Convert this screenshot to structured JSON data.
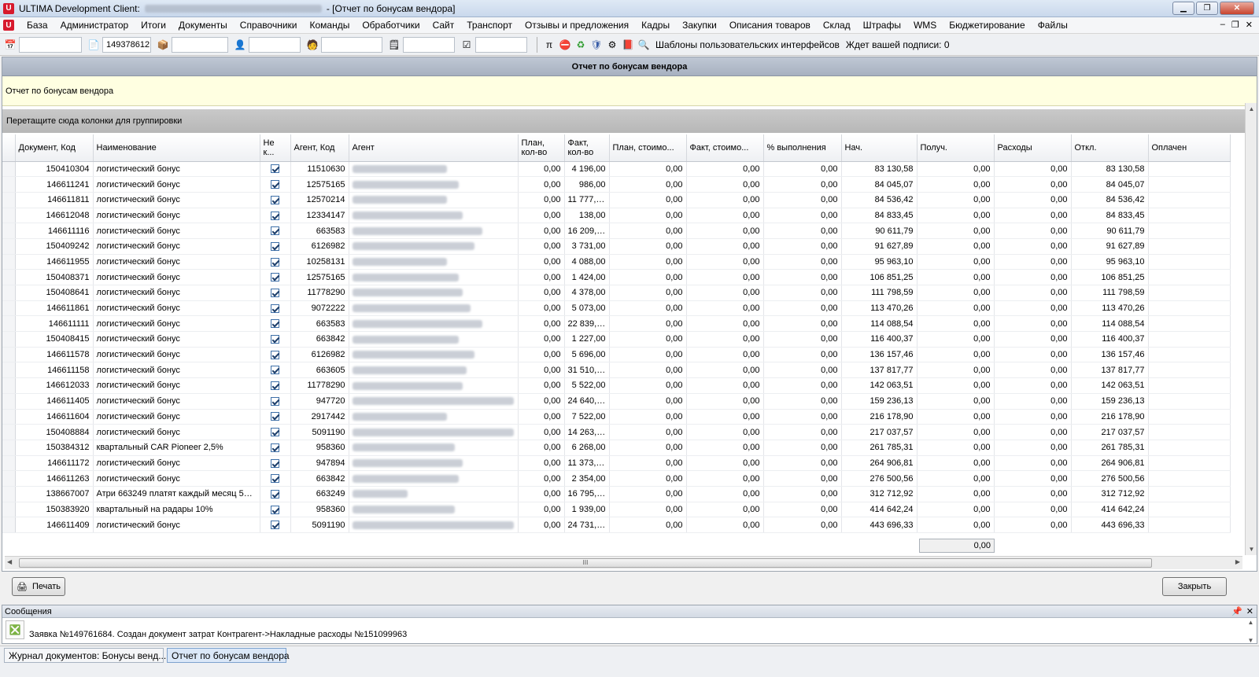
{
  "window": {
    "title_prefix": "ULTIMA Development Client:",
    "title_suffix": "- [Отчет по бонусам вендора]",
    "min_label": "▁",
    "max_label": "❐",
    "close_label": "✕"
  },
  "menu": {
    "items": [
      "База",
      "Администратор",
      "Итоги",
      "Документы",
      "Справочники",
      "Команды",
      "Обработчики",
      "Сайт",
      "Транспорт",
      "Отзывы и предложения",
      "Кадры",
      "Закупки",
      "Описания товаров",
      "Склад",
      "Штрафы",
      "WMS",
      "Бюджетирование",
      "Файлы"
    ],
    "right": [
      "–",
      "❐",
      "✕"
    ]
  },
  "toolbar": {
    "field_value": "149378612",
    "templates_label": "Шаблоны пользовательских интерфейсов",
    "await_label": "Ждет вашей подписи: 0"
  },
  "report": {
    "header": "Отчет по бонусам вендора",
    "description": "Отчет по бонусам вендора",
    "group_hint": "Перетащите сюда колонки для группировки",
    "columns": [
      "Документ, Код",
      "Наименование",
      "Не к...",
      "Агент, Код",
      "Агент",
      "План, кол-во",
      "Факт, кол-во",
      "План, стоимо...",
      "Факт, стоимо...",
      "% выполнения",
      "Нач.",
      "Получ.",
      "Расходы",
      "Откл.",
      "Оплачен"
    ],
    "rows": [
      {
        "doc": "150410304",
        "name": "логистический бонус",
        "agent_code": "11510630",
        "plan_qty": "0,00",
        "fact_qty": "4 196,00",
        "plan_cost": "0,00",
        "fact_cost": "0,00",
        "pct": "0,00",
        "nach": "83 130,58",
        "poluch": "0,00",
        "rashod": "0,00",
        "otkl": "83 130,58"
      },
      {
        "doc": "146611241",
        "name": "логистический бонус",
        "agent_code": "12575165",
        "plan_qty": "0,00",
        "fact_qty": "986,00",
        "plan_cost": "0,00",
        "fact_cost": "0,00",
        "pct": "0,00",
        "nach": "84 045,07",
        "poluch": "0,00",
        "rashod": "0,00",
        "otkl": "84 045,07"
      },
      {
        "doc": "146611811",
        "name": "логистический бонус",
        "agent_code": "12570214",
        "plan_qty": "0,00",
        "fact_qty": "11 777,00",
        "plan_cost": "0,00",
        "fact_cost": "0,00",
        "pct": "0,00",
        "nach": "84 536,42",
        "poluch": "0,00",
        "rashod": "0,00",
        "otkl": "84 536,42"
      },
      {
        "doc": "146612048",
        "name": "логистический бонус",
        "agent_code": "12334147",
        "plan_qty": "0,00",
        "fact_qty": "138,00",
        "plan_cost": "0,00",
        "fact_cost": "0,00",
        "pct": "0,00",
        "nach": "84 833,45",
        "poluch": "0,00",
        "rashod": "0,00",
        "otkl": "84 833,45"
      },
      {
        "doc": "146611116",
        "name": "логистический бонус",
        "agent_code": "663583",
        "plan_qty": "0,00",
        "fact_qty": "16 209,00",
        "plan_cost": "0,00",
        "fact_cost": "0,00",
        "pct": "0,00",
        "nach": "90 611,79",
        "poluch": "0,00",
        "rashod": "0,00",
        "otkl": "90 611,79"
      },
      {
        "doc": "150409242",
        "name": "логистический бонус",
        "agent_code": "6126982",
        "plan_qty": "0,00",
        "fact_qty": "3 731,00",
        "plan_cost": "0,00",
        "fact_cost": "0,00",
        "pct": "0,00",
        "nach": "91 627,89",
        "poluch": "0,00",
        "rashod": "0,00",
        "otkl": "91 627,89"
      },
      {
        "doc": "146611955",
        "name": "логистический бонус",
        "agent_code": "10258131",
        "plan_qty": "0,00",
        "fact_qty": "4 088,00",
        "plan_cost": "0,00",
        "fact_cost": "0,00",
        "pct": "0,00",
        "nach": "95 963,10",
        "poluch": "0,00",
        "rashod": "0,00",
        "otkl": "95 963,10"
      },
      {
        "doc": "150408371",
        "name": "логистический бонус",
        "agent_code": "12575165",
        "plan_qty": "0,00",
        "fact_qty": "1 424,00",
        "plan_cost": "0,00",
        "fact_cost": "0,00",
        "pct": "0,00",
        "nach": "106 851,25",
        "poluch": "0,00",
        "rashod": "0,00",
        "otkl": "106 851,25"
      },
      {
        "doc": "150408641",
        "name": "логистический бонус",
        "agent_code": "11778290",
        "plan_qty": "0,00",
        "fact_qty": "4 378,00",
        "plan_cost": "0,00",
        "fact_cost": "0,00",
        "pct": "0,00",
        "nach": "111 798,59",
        "poluch": "0,00",
        "rashod": "0,00",
        "otkl": "111 798,59"
      },
      {
        "doc": "146611861",
        "name": "логистический бонус",
        "agent_code": "9072222",
        "plan_qty": "0,00",
        "fact_qty": "5 073,00",
        "plan_cost": "0,00",
        "fact_cost": "0,00",
        "pct": "0,00",
        "nach": "113 470,26",
        "poluch": "0,00",
        "rashod": "0,00",
        "otkl": "113 470,26"
      },
      {
        "doc": "146611111",
        "name": "логистический бонус",
        "agent_code": "663583",
        "plan_qty": "0,00",
        "fact_qty": "22 839,00",
        "plan_cost": "0,00",
        "fact_cost": "0,00",
        "pct": "0,00",
        "nach": "114 088,54",
        "poluch": "0,00",
        "rashod": "0,00",
        "otkl": "114 088,54"
      },
      {
        "doc": "150408415",
        "name": "логистический бонус",
        "agent_code": "663842",
        "plan_qty": "0,00",
        "fact_qty": "1 227,00",
        "plan_cost": "0,00",
        "fact_cost": "0,00",
        "pct": "0,00",
        "nach": "116 400,37",
        "poluch": "0,00",
        "rashod": "0,00",
        "otkl": "116 400,37"
      },
      {
        "doc": "146611578",
        "name": "логистический бонус",
        "agent_code": "6126982",
        "plan_qty": "0,00",
        "fact_qty": "5 696,00",
        "plan_cost": "0,00",
        "fact_cost": "0,00",
        "pct": "0,00",
        "nach": "136 157,46",
        "poluch": "0,00",
        "rashod": "0,00",
        "otkl": "136 157,46"
      },
      {
        "doc": "146611158",
        "name": "логистический бонус",
        "agent_code": "663605",
        "plan_qty": "0,00",
        "fact_qty": "31 510,00",
        "plan_cost": "0,00",
        "fact_cost": "0,00",
        "pct": "0,00",
        "nach": "137 817,77",
        "poluch": "0,00",
        "rashod": "0,00",
        "otkl": "137 817,77"
      },
      {
        "doc": "146612033",
        "name": "логистический бонус",
        "agent_code": "11778290",
        "plan_qty": "0,00",
        "fact_qty": "5 522,00",
        "plan_cost": "0,00",
        "fact_cost": "0,00",
        "pct": "0,00",
        "nach": "142 063,51",
        "poluch": "0,00",
        "rashod": "0,00",
        "otkl": "142 063,51"
      },
      {
        "doc": "146611405",
        "name": "логистический бонус",
        "agent_code": "947720",
        "plan_qty": "0,00",
        "fact_qty": "24 640,00",
        "plan_cost": "0,00",
        "fact_cost": "0,00",
        "pct": "0,00",
        "nach": "159 236,13",
        "poluch": "0,00",
        "rashod": "0,00",
        "otkl": "159 236,13"
      },
      {
        "doc": "146611604",
        "name": "логистический бонус",
        "agent_code": "2917442",
        "plan_qty": "0,00",
        "fact_qty": "7 522,00",
        "plan_cost": "0,00",
        "fact_cost": "0,00",
        "pct": "0,00",
        "nach": "216 178,90",
        "poluch": "0,00",
        "rashod": "0,00",
        "otkl": "216 178,90"
      },
      {
        "doc": "150408884",
        "name": "логистический бонус",
        "agent_code": "5091190",
        "plan_qty": "0,00",
        "fact_qty": "14 263,00",
        "plan_cost": "0,00",
        "fact_cost": "0,00",
        "pct": "0,00",
        "nach": "217 037,57",
        "poluch": "0,00",
        "rashod": "0,00",
        "otkl": "217 037,57"
      },
      {
        "doc": "150384312",
        "name": "квартальный CAR Pioneer 2,5%",
        "agent_code": "958360",
        "plan_qty": "0,00",
        "fact_qty": "6 268,00",
        "plan_cost": "0,00",
        "fact_cost": "0,00",
        "pct": "0,00",
        "nach": "261 785,31",
        "poluch": "0,00",
        "rashod": "0,00",
        "otkl": "261 785,31"
      },
      {
        "doc": "146611172",
        "name": "логистический бонус",
        "agent_code": "947894",
        "plan_qty": "0,00",
        "fact_qty": "11 373,00",
        "plan_cost": "0,00",
        "fact_cost": "0,00",
        "pct": "0,00",
        "nach": "264 906,81",
        "poluch": "0,00",
        "rashod": "0,00",
        "otkl": "264 906,81"
      },
      {
        "doc": "146611263",
        "name": "логистический бонус",
        "agent_code": "663842",
        "plan_qty": "0,00",
        "fact_qty": "2 354,00",
        "plan_cost": "0,00",
        "fact_cost": "0,00",
        "pct": "0,00",
        "nach": "276 500,56",
        "poluch": "0,00",
        "rashod": "0,00",
        "otkl": "276 500,56"
      },
      {
        "doc": "138667007",
        "name": "Атри 663249 платят каждый месяц 5%...",
        "agent_code": "663249",
        "plan_qty": "0,00",
        "fact_qty": "16 795,00",
        "plan_cost": "0,00",
        "fact_cost": "0,00",
        "pct": "0,00",
        "nach": "312 712,92",
        "poluch": "0,00",
        "rashod": "0,00",
        "otkl": "312 712,92"
      },
      {
        "doc": "150383920",
        "name": "квартальный на радары 10%",
        "agent_code": "958360",
        "plan_qty": "0,00",
        "fact_qty": "1 939,00",
        "plan_cost": "0,00",
        "fact_cost": "0,00",
        "pct": "0,00",
        "nach": "414 642,24",
        "poluch": "0,00",
        "rashod": "0,00",
        "otkl": "414 642,24"
      },
      {
        "doc": "146611409",
        "name": "логистический бонус",
        "agent_code": "5091190",
        "plan_qty": "0,00",
        "fact_qty": "24 731,00",
        "plan_cost": "0,00",
        "fact_cost": "0,00",
        "pct": "0,00",
        "nach": "443 696,33",
        "poluch": "0,00",
        "rashod": "0,00",
        "otkl": "443 696,33"
      }
    ],
    "summary_value": "0,00",
    "scroll_grip": "III"
  },
  "buttons": {
    "print_label": "Печать",
    "close_label": "Закрыть"
  },
  "messages": {
    "title": "Сообщения",
    "text": "Заявка №149761684. Создан документ затрат Контрагент->Накладные расходы №151099963"
  },
  "taskbar": {
    "tab1": "Журнал документов: Бонусы венд...",
    "tab2": "Отчет по бонусам вендора"
  }
}
